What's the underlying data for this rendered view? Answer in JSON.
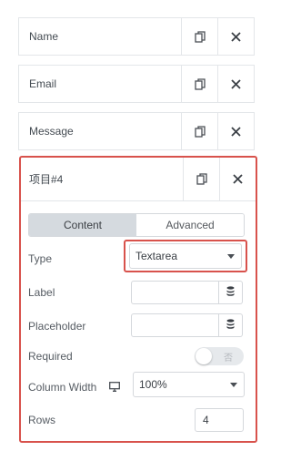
{
  "items": [
    {
      "title": "Name"
    },
    {
      "title": "Email"
    },
    {
      "title": "Message"
    }
  ],
  "active_item": {
    "title": "项目#4",
    "tabs": {
      "content": "Content",
      "advanced": "Advanced",
      "selected": "Content"
    },
    "type": {
      "label": "Type",
      "value": "Textarea"
    },
    "label_field": {
      "label": "Label",
      "value": ""
    },
    "placeholder_field": {
      "label": "Placeholder",
      "value": ""
    },
    "required": {
      "label": "Required",
      "state_text": "否",
      "on": false
    },
    "column_width": {
      "label": "Column Width",
      "value": "100%"
    },
    "rows": {
      "label": "Rows",
      "value": "4"
    }
  },
  "icons": {
    "duplicate": "copy-icon",
    "remove": "close-icon",
    "dynamic": "database-icon",
    "responsive": "desktop-icon"
  },
  "colors": {
    "highlight": "#d8524c",
    "border": "#e3e6e9",
    "tab_active_bg": "#d5dadf"
  }
}
